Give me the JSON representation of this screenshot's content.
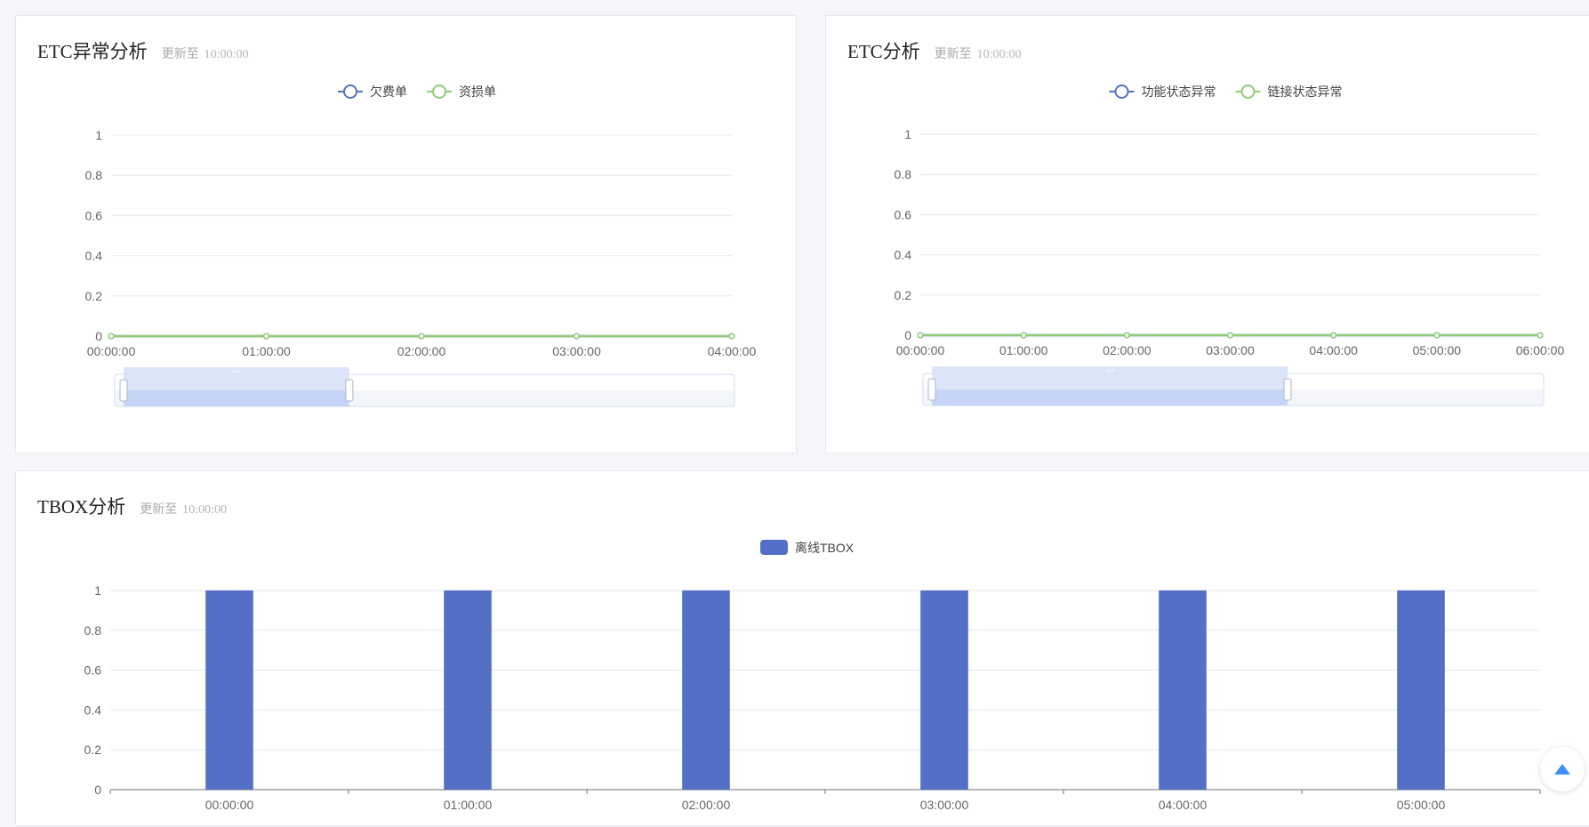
{
  "cards": [
    {
      "title": "ETC异常分析",
      "update_label": "更新至",
      "update_time": "10:00:00"
    },
    {
      "title": "ETC分析",
      "update_label": "更新至",
      "update_time": "10:00:00"
    },
    {
      "title": "TBOX分析",
      "update_label": "更新至",
      "update_time": "10:00:00"
    }
  ],
  "back_to_top": {
    "icon": "triangle-up-icon",
    "color": "#3e8ef7"
  },
  "chart_data": [
    {
      "type": "line",
      "legend_position": "top-center",
      "x": [
        "00:00:00",
        "01:00:00",
        "02:00:00",
        "03:00:00",
        "04:00:00"
      ],
      "series": [
        {
          "name": "欠费单",
          "values": [
            0,
            0,
            0,
            0,
            0
          ],
          "color": "#5470c6"
        },
        {
          "name": "资损单",
          "values": [
            0,
            0,
            0,
            0,
            0
          ],
          "color": "#91cc75"
        }
      ],
      "yticks": [
        "0",
        "0.2",
        "0.4",
        "0.6",
        "0.8",
        "1"
      ],
      "ylim": [
        0,
        1
      ],
      "grid": true,
      "datazoom": {
        "start": 0,
        "end": 0.375
      }
    },
    {
      "type": "line",
      "legend_position": "top-center",
      "x": [
        "00:00:00",
        "01:00:00",
        "02:00:00",
        "03:00:00",
        "04:00:00",
        "05:00:00",
        "06:00:00"
      ],
      "series": [
        {
          "name": "功能状态异常",
          "values": [
            0,
            0,
            0,
            0,
            0,
            0,
            0
          ],
          "color": "#5470c6"
        },
        {
          "name": "链接状态异常",
          "values": [
            0,
            0,
            0,
            0,
            0,
            0,
            0
          ],
          "color": "#91cc75"
        }
      ],
      "yticks": [
        "0",
        "0.2",
        "0.4",
        "0.6",
        "0.8",
        "1"
      ],
      "ylim": [
        0,
        1
      ],
      "grid": true,
      "datazoom": {
        "start": 0,
        "end": 0.59
      }
    },
    {
      "type": "bar",
      "legend_position": "top-center",
      "categories": [
        "00:00:00",
        "01:00:00",
        "02:00:00",
        "03:00:00",
        "04:00:00",
        "05:00:00"
      ],
      "series": [
        {
          "name": "离线TBOX",
          "values": [
            1,
            1,
            1,
            1,
            1,
            1
          ],
          "color": "#5470c6"
        }
      ],
      "yticks": [
        "0",
        "0.2",
        "0.4",
        "0.6",
        "0.8",
        "1"
      ],
      "ylim": [
        0,
        1
      ],
      "grid": true
    }
  ]
}
